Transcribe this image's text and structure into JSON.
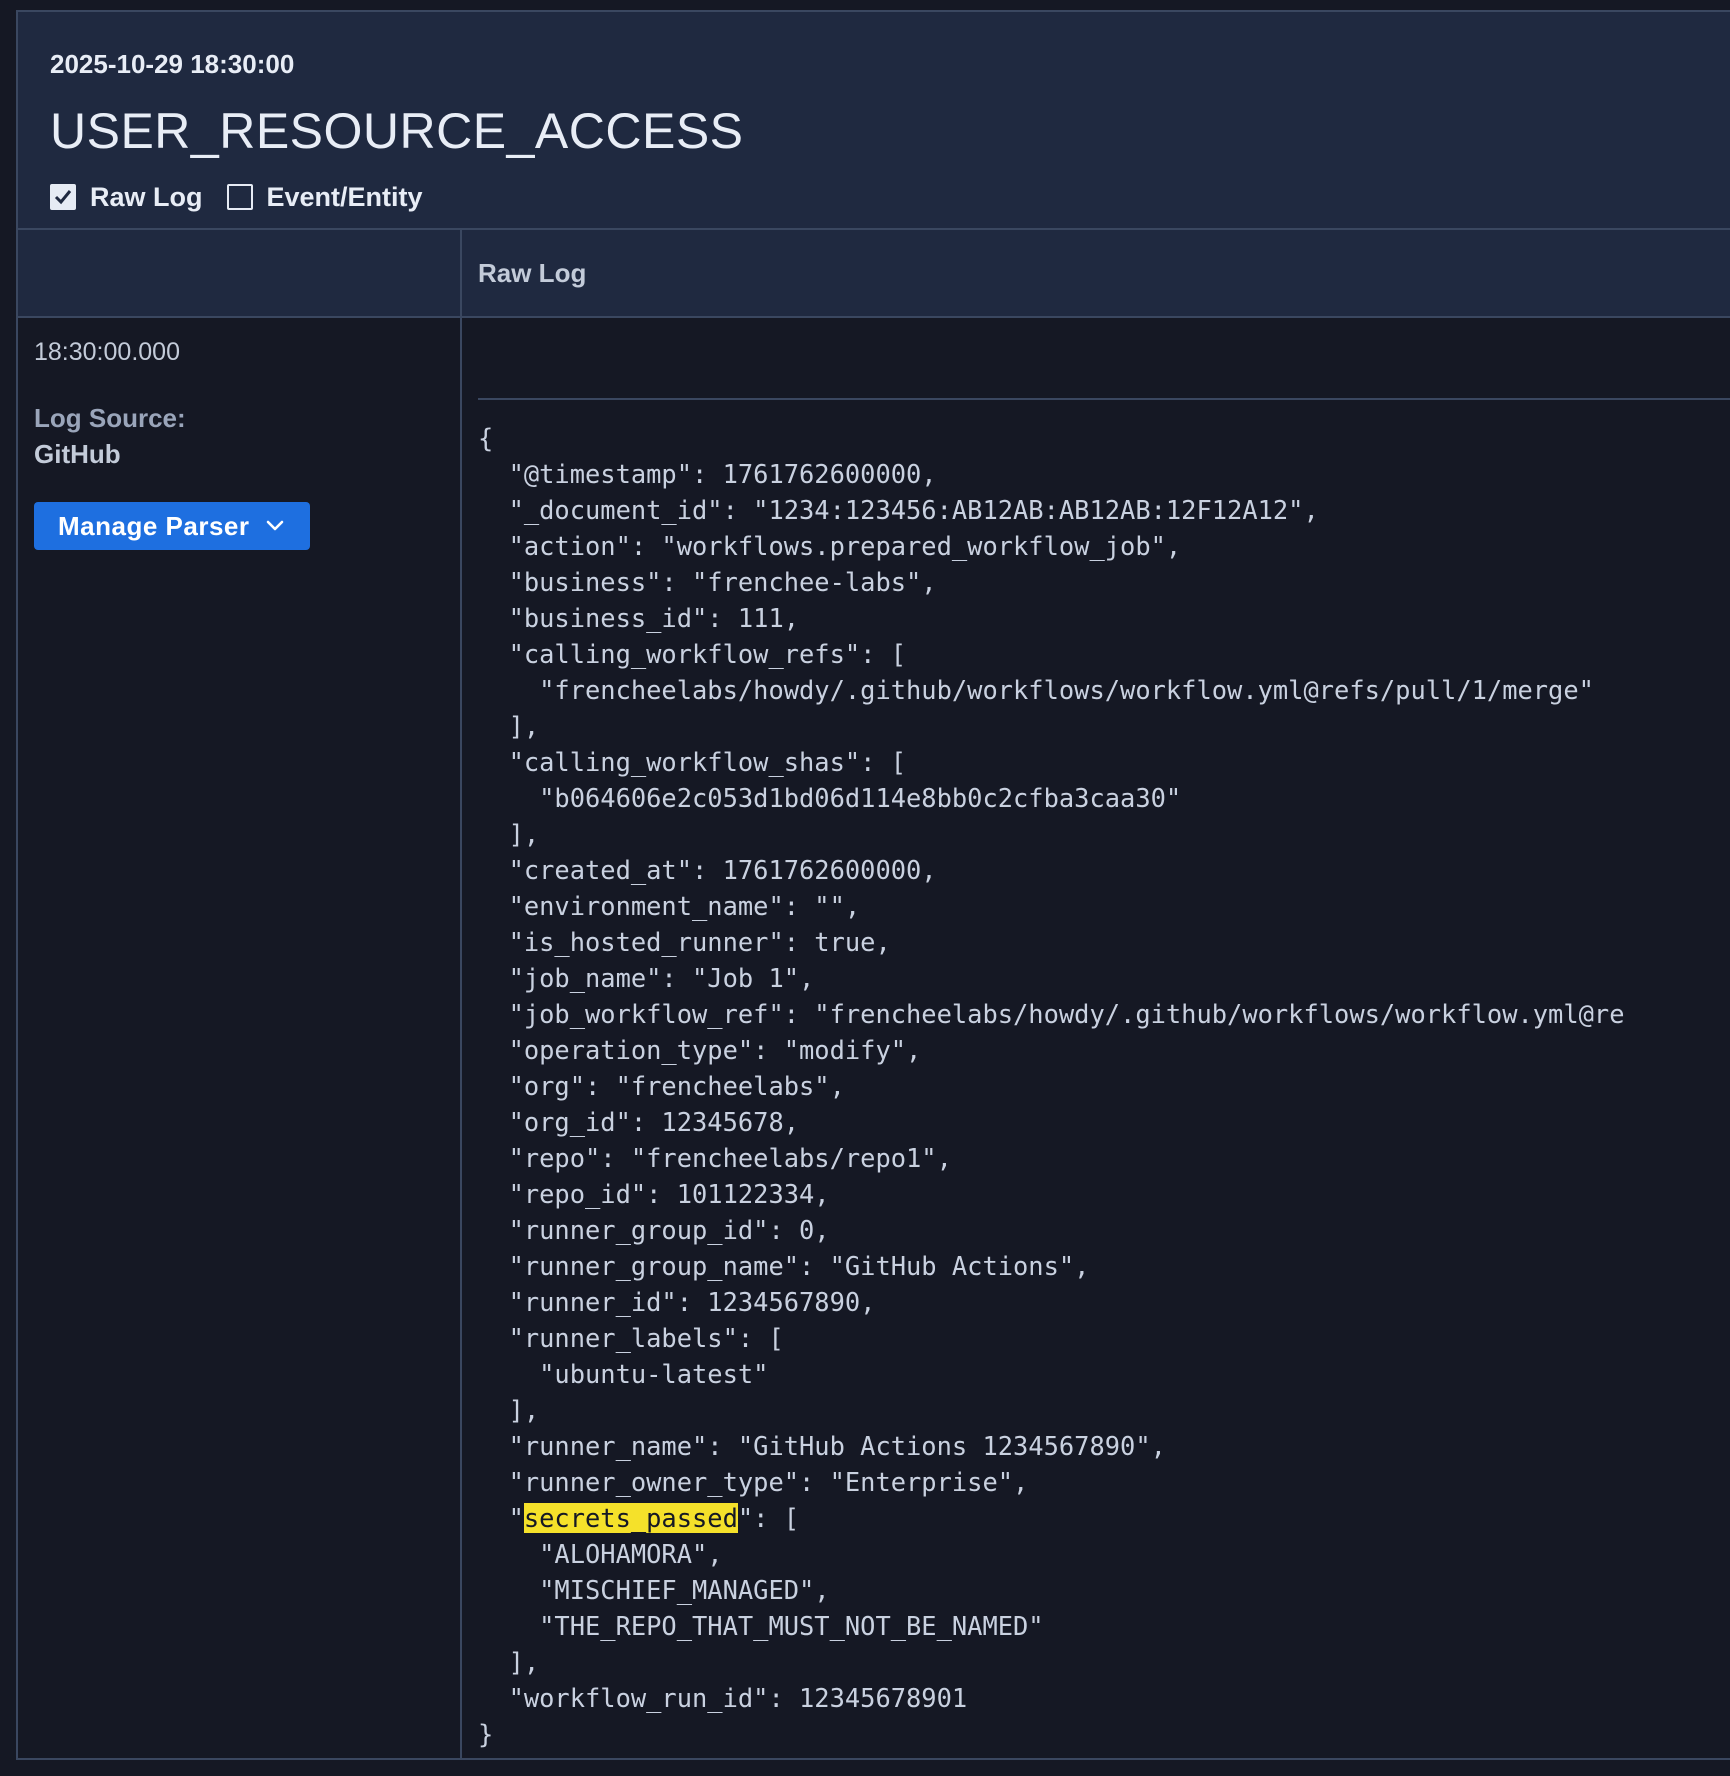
{
  "header": {
    "date": "2025-10-29 18:30:00",
    "title": "USER_RESOURCE_ACCESS",
    "checks": [
      {
        "label": "Raw Log",
        "checked": true
      },
      {
        "label": "Event/Entity",
        "checked": false
      }
    ]
  },
  "table": {
    "col_header": "Raw Log"
  },
  "left": {
    "time": "18:30:00.000",
    "source_label": "Log Source:",
    "source_value": "GitHub",
    "manage_button": "Manage Parser",
    "chevron_icon": "chevron-down-icon"
  },
  "raw_log": {
    "highlight_term": "secrets_passed",
    "lines": [
      "{",
      "  \"@timestamp\": 1761762600000,",
      "  \"_document_id\": \"1234:123456:AB12AB:AB12AB:12F12A12\",",
      "  \"action\": \"workflows.prepared_workflow_job\",",
      "  \"business\": \"frenchee-labs\",",
      "  \"business_id\": 111,",
      "  \"calling_workflow_refs\": [",
      "    \"frencheelabs/howdy/.github/workflows/workflow.yml@refs/pull/1/merge\"",
      "  ],",
      "  \"calling_workflow_shas\": [",
      "    \"b064606e2c053d1bd06d114e8bb0c2cfba3caa30\"",
      "  ],",
      "  \"created_at\": 1761762600000,",
      "  \"environment_name\": \"\",",
      "  \"is_hosted_runner\": true,",
      "  \"job_name\": \"Job 1\",",
      "  \"job_workflow_ref\": \"frencheelabs/howdy/.github/workflows/workflow.yml@re",
      "  \"operation_type\": \"modify\",",
      "  \"org\": \"frencheelabs\",",
      "  \"org_id\": 12345678,",
      "  \"repo\": \"frencheelabs/repo1\",",
      "  \"repo_id\": 101122334,",
      "  \"runner_group_id\": 0,",
      "  \"runner_group_name\": \"GitHub Actions\",",
      "  \"runner_id\": 1234567890,",
      "  \"runner_labels\": [",
      "    \"ubuntu-latest\"",
      "  ],",
      "  \"runner_name\": \"GitHub Actions 1234567890\",",
      "  \"runner_owner_type\": \"Enterprise\",",
      "  \"secrets_passed\": [",
      "    \"ALOHAMORA\",",
      "    \"MISCHIEF_MANAGED\",",
      "    \"THE_REPO_THAT_MUST_NOT_BE_NAMED\"",
      "  ],",
      "  \"workflow_run_id\": 12345678901",
      "}"
    ]
  },
  "colors": {
    "accent": "#1e6fe0",
    "highlight": "#f5e12a",
    "header_bg": "#1f2940",
    "body_bg": "#151824"
  }
}
